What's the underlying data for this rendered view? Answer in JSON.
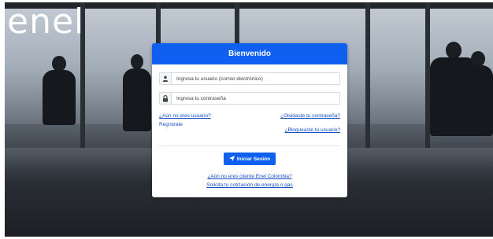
{
  "brand": {
    "logo_text": "enel"
  },
  "login_card": {
    "title": "Bienvenido",
    "username": {
      "placeholder": "Ingresa tu usuario (correo electrónico)",
      "value": "",
      "icon": "user-icon"
    },
    "password": {
      "placeholder": "Ingresa tu contraseña",
      "value": "",
      "icon": "lock-icon"
    },
    "not_user_text": "¿Aún no eres usuario?",
    "register_link": "Regístrate",
    "forgot_password_link": "¿Olvidaste tu contraseña?",
    "blocked_user_link": "¿Bloqueaste tu usuario?",
    "login_button_label": "Iniciar Sesión",
    "login_button_icon": "paper-plane-icon",
    "not_client_link": "¿Aún no eres cliente Enel Colombia?",
    "quote_link": "Solicita tu cotización de energía o gas"
  },
  "colors": {
    "primary": "#0f5ff0",
    "link": "#1750c9",
    "logo": "#ffffff"
  }
}
